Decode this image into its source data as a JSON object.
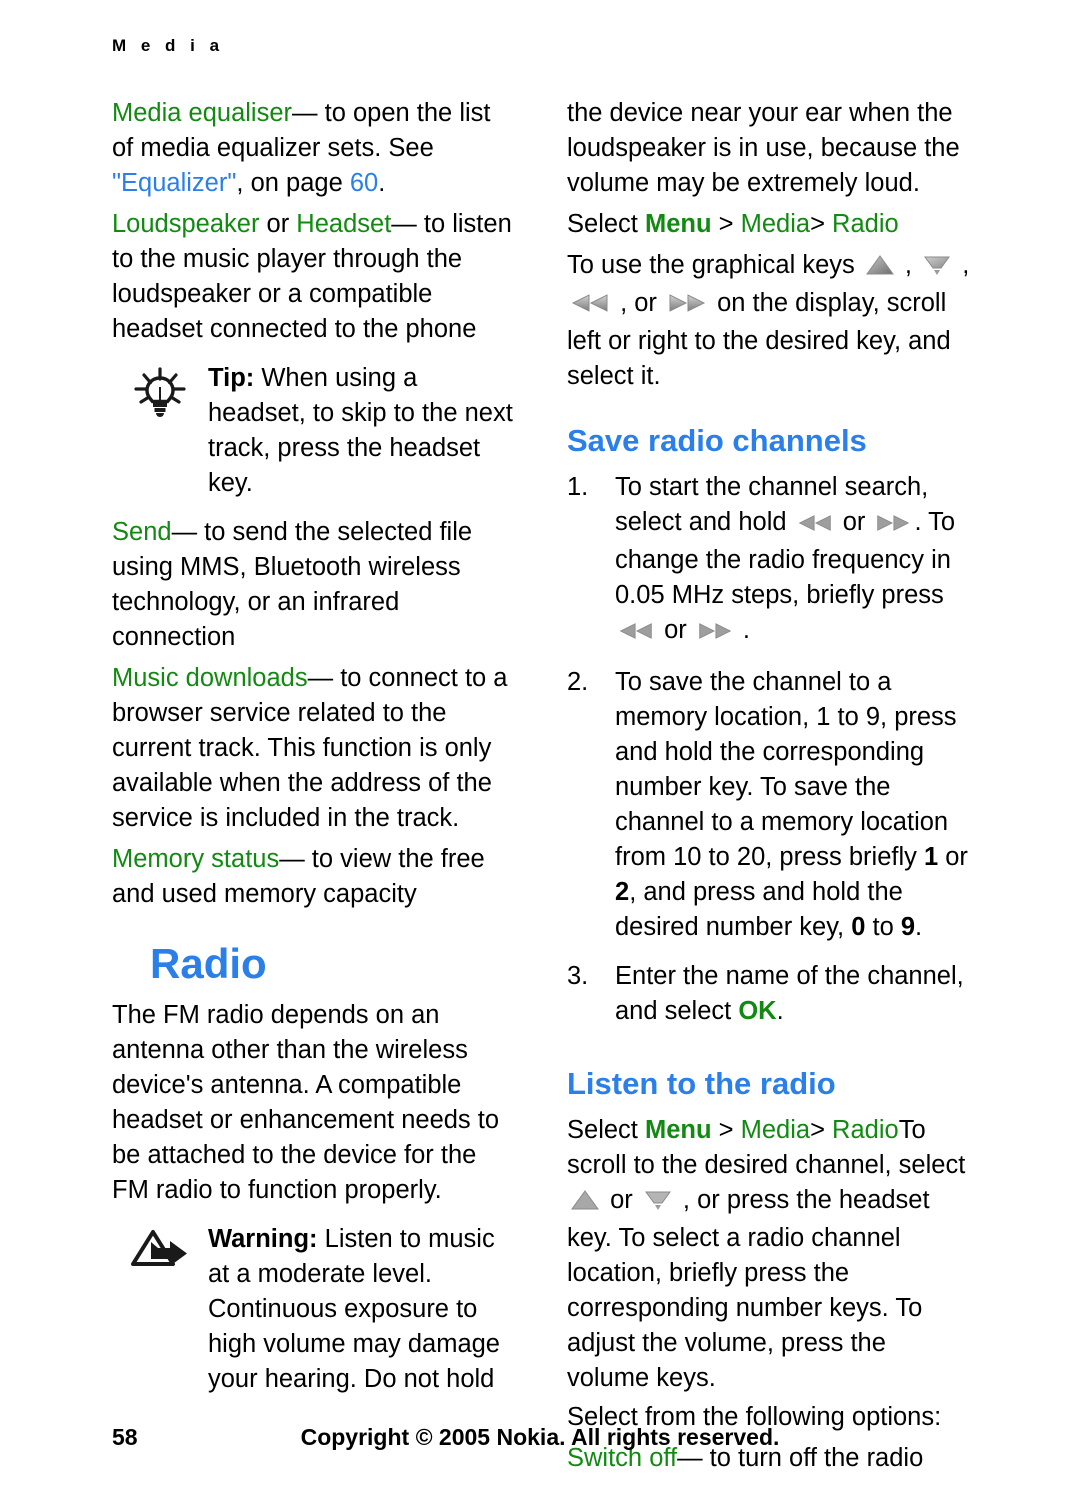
{
  "running_head": "M e d i a",
  "colors": {
    "keyword_green": "#128a12",
    "link_blue": "#2a7fe8",
    "heading_blue": "#2a7fe8",
    "text_black": "#000000",
    "key_icon_gray": "#8c8c8c"
  },
  "left_column": {
    "media_equaliser": {
      "keyword": "Media equaliser",
      "dash": "—",
      "text_a": " to open the list of media equalizer sets. See ",
      "link_title": "\"Equalizer\"",
      "text_b": ", on page ",
      "link_page": "60",
      "text_c": "."
    },
    "loudspeaker": {
      "keyword_a": "Loudspeaker",
      "joiner": " or ",
      "keyword_b": "Headset",
      "dash": "—",
      "text": " to listen to the music player through the loudspeaker or a compatible headset connected to the phone"
    },
    "tip": {
      "icon": "lightbulb-icon",
      "label": "Tip:",
      "text": " When using a headset, to skip to the next track, press the headset key."
    },
    "send": {
      "keyword": "Send",
      "dash": "—",
      "text": " to send the selected file using MMS, Bluetooth wireless technology, or an infrared connection"
    },
    "music_downloads": {
      "keyword": "Music downloads",
      "dash": "—",
      "text": " to connect to a browser service related to the current track. This function is only available when the address of the service is included in the track."
    },
    "memory_status": {
      "keyword": "Memory status",
      "dash": "—",
      "text": " to view the free and used memory capacity"
    },
    "chapter_heading": "Radio",
    "radio_intro": "The FM radio depends on an antenna other than the wireless device's antenna. A compatible headset or enhancement needs to be attached to the device for the FM radio to function properly.",
    "warning": {
      "icon": "warning-triangle-arrow-icon",
      "label": "Warning:",
      "text": " Listen to music at a moderate level. Continuous exposure to high volume may damage your hearing. Do not hold"
    }
  },
  "right_column": {
    "warning_continued": "the device near your ear when the loudspeaker is in use, because the volume may be extremely loud.",
    "select_path_1": {
      "select": "Select ",
      "menu": "Menu",
      "sep1": " > ",
      "media": "Media",
      "sep2": "> ",
      "radio": "Radio"
    },
    "graphical_keys": {
      "text_a": "To use the graphical keys ",
      "icon_up": "key-up-icon",
      "comma_1": " , ",
      "icon_down": "key-down-icon",
      "comma_2": " , ",
      "icon_rewind": "key-rewind-icon",
      "text_b": " , or ",
      "icon_forward": "key-forward-icon",
      "text_c": " on the display, scroll left or right to the desired key, and select it."
    },
    "save_heading": "Save radio channels",
    "steps": [
      {
        "num": "1.",
        "text_a": "To start the channel search, select and hold ",
        "icon_1": "key-rewind-icon",
        "text_b": " or ",
        "icon_2": "key-forward-icon",
        "text_c": ". To change the radio frequency in 0.05 MHz steps, briefly press ",
        "icon_3": "key-rewind-icon",
        "text_d": " or ",
        "icon_4": "key-forward-icon",
        "text_e": " ."
      },
      {
        "num": "2.",
        "text_a": "To save the channel to a memory location, 1 to 9, press and hold the corresponding number key. To save the channel to a memory location from 10 to 20, press briefly ",
        "bold_1": "1",
        "text_b": " or ",
        "bold_2": "2",
        "text_c": ", and press and hold the desired number key, ",
        "bold_3": "0",
        "text_d": " to ",
        "bold_4": "9",
        "text_e": "."
      },
      {
        "num": "3.",
        "text_a": "Enter the name of the channel, and select ",
        "keyword": "OK",
        "text_b": "."
      }
    ],
    "listen_heading": "Listen to the radio",
    "select_path_2": {
      "select": "Select ",
      "menu": "Menu",
      "sep1": " > ",
      "media": "Media",
      "sep2": "> ",
      "radio": "Radio"
    },
    "listen_body": {
      "text_a": "To scroll to the desired channel, select ",
      "icon_up": "key-up-icon",
      "text_b": " or ",
      "icon_down": "key-down-icon",
      "text_c": " , or press the headset key. To select a radio channel location, briefly press the corresponding number keys. To adjust the volume, press the volume keys."
    },
    "options_intro": "Select from the following options:",
    "switch_off": {
      "keyword": "Switch off",
      "dash": "—",
      "text": " to turn off the radio"
    }
  },
  "footer": {
    "page_number": "58",
    "copyright": "Copyright © 2005 Nokia. All rights reserved."
  }
}
